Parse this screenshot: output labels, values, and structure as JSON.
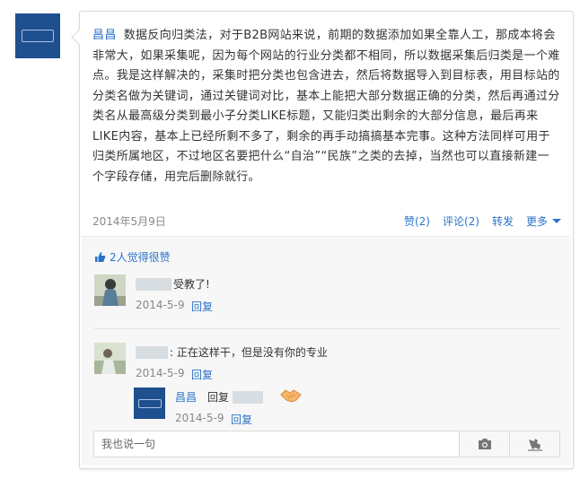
{
  "post": {
    "author": "昌昌",
    "body": "数据反向归类法，对于B2B网站来说，前期的数据添加如果全靠人工，那成本将会非常大，如果采集呢，因为每个网站的行业分类都不相同，所以数据采集后归类是一个难点。我是这样解决的，采集时把分类也包含进去，然后将数据导入到目标表，用目标站的分类名做为关键词，通过关键词对比，基本上能把大部分数据正确的分类，然后再通过分类名从最高级分类到最小子分类LIKE标题，又能归类出剩余的大部分信息，最后再来LIKE内容，基本上已经所剩不多了，剩余的再手动搞搞基本完事。这种方法同样可用于归类所属地区，不过地区名要把什么“自治”“民族”之类的去掉，当然也可以直接新建一个字段存储，用完后删除就行。",
    "date": "2014年5月9日",
    "actions": {
      "like": "赞(2)",
      "comment": "评论(2)",
      "share": "转发",
      "more": "更多"
    }
  },
  "likes_text": "2人觉得很赞",
  "comments": [
    {
      "text": "受教了!",
      "date": "2014-5-9",
      "reply_label": "回复"
    },
    {
      "text": ": 正在这样干，但是没有你的专业",
      "date": "2014-5-9",
      "reply_label": "回复"
    }
  ],
  "reply": {
    "author": "昌昌",
    "prefix": "回复",
    "date": "2014-5-9",
    "reply_label": "回复"
  },
  "input": {
    "placeholder": "我也说一句"
  },
  "icons": {
    "camera": "camera-icon",
    "send": "send-icon",
    "thumb": "thumbs-up-icon",
    "handshake": "handshake-emoji-icon"
  },
  "colors": {
    "link": "#2b73c8",
    "avatar_blue": "#1e4f8e"
  }
}
